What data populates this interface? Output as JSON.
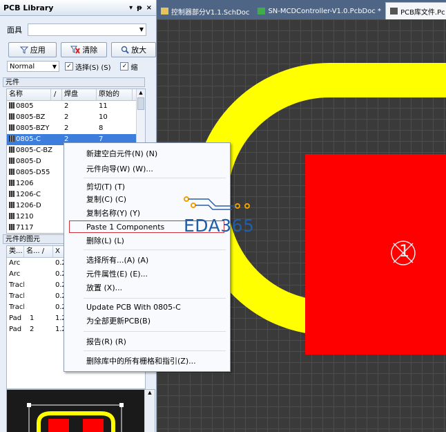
{
  "panel": {
    "title": "PCB Library",
    "controls": [
      "▾",
      "ᵽ",
      "×"
    ],
    "mask_label": "面具",
    "buttons": {
      "apply": "应用",
      "clear": "清除",
      "zoom": "放大"
    },
    "mode": "Normal",
    "select_label": "选择(S) (S)",
    "select_checked": true,
    "zoom_label": "缩",
    "components_header": "元件",
    "comp_columns": [
      "名称",
      "/",
      "焊盘",
      "原始的"
    ],
    "components": [
      {
        "name": "0805",
        "pads": "2",
        "primitives": "11"
      },
      {
        "name": "0805-BZ",
        "pads": "2",
        "primitives": "10"
      },
      {
        "name": "0805-BZY",
        "pads": "2",
        "primitives": "8"
      },
      {
        "name": "0805-C",
        "pads": "2",
        "primitives": "7"
      },
      {
        "name": "0805-C-BZ",
        "pads": "",
        "primitives": ""
      },
      {
        "name": "0805-D",
        "pads": "",
        "primitives": ""
      },
      {
        "name": "0805-D55",
        "pads": "",
        "primitives": ""
      },
      {
        "name": "1206",
        "pads": "",
        "primitives": ""
      },
      {
        "name": "1206-C",
        "pads": "",
        "primitives": ""
      },
      {
        "name": "1206-D",
        "pads": "",
        "primitives": ""
      },
      {
        "name": "1210",
        "pads": "",
        "primitives": ""
      },
      {
        "name": "7117",
        "pads": "",
        "primitives": ""
      }
    ],
    "selected_component_index": 3,
    "primitives_header": "元件的图元",
    "prim_columns": [
      "类...",
      "名... /",
      "X"
    ],
    "primitives": [
      {
        "type": "Arc",
        "name": "",
        "x": "0.2"
      },
      {
        "type": "Arc",
        "name": "",
        "x": "0.2"
      },
      {
        "type": "Track",
        "name": "",
        "x": "0.2"
      },
      {
        "type": "Track",
        "name": "",
        "x": "0.2"
      },
      {
        "type": "Track",
        "name": "",
        "x": "0.2"
      },
      {
        "type": "Pad",
        "name": "1",
        "x": "1.2"
      },
      {
        "type": "Pad",
        "name": "2",
        "x": "1.2"
      }
    ]
  },
  "tabs": [
    {
      "label": "控制器部分V1.1.SchDoc",
      "color": "#e8c25a",
      "active": false
    },
    {
      "label": "SN-MCDController-V1.0.PcbDoc *",
      "color": "#3fae48",
      "active": false
    },
    {
      "label": "PCB库文件.Pc",
      "color": "#555555",
      "active": true
    }
  ],
  "context_menu": {
    "items": [
      "新建空白元件(N) (N)",
      "元件向导(W) (W)...",
      "剪切(T) (T)",
      "复制(C) (C)",
      "复制名称(Y) (Y)",
      "Paste 1 Components",
      "删除(L) (L)",
      "选择所有...(A) (A)",
      "元件属性(E) (E)...",
      "放置 (X)...",
      "Update PCB With 0805-C",
      "为全部更新PCB(B)",
      "报告(R) (R)",
      "删除库中的所有栅格和指引(Z)..."
    ],
    "highlighted": "Paste 1 Components"
  },
  "canvas": {
    "pad_label": "1",
    "colors": {
      "silkscreen": "#ffff00",
      "pad": "#ff0000",
      "grid_bg": "#3a3a3a"
    }
  },
  "watermark": "EDA365"
}
